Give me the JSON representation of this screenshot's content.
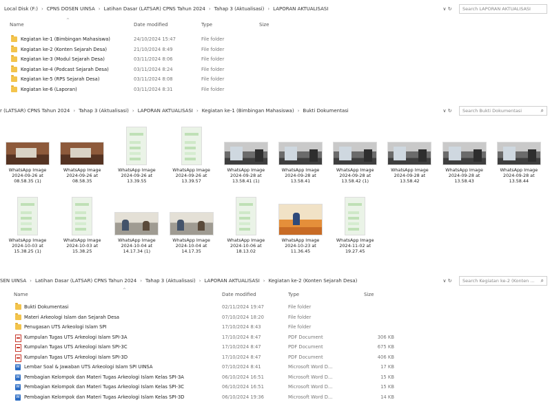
{
  "pane1": {
    "breadcrumb": [
      "Local Disk (F:)",
      "CPNS DOSEN UINSA",
      "Latihan Dasar (LATSAR) CPNS Tahun 2024",
      "Tahap 3 (Aktualisasi)",
      "LAPORAN AKTUALISASI"
    ],
    "search_placeholder": "Search LAPORAN AKTUALISASI",
    "columns": {
      "name": "Name",
      "date": "Date modified",
      "type": "Type",
      "size": "Size"
    },
    "rows": [
      {
        "name": "Kegiatan ke-1 (Bimbingan Mahasiswa)",
        "date": "24/10/2024 15:47",
        "type": "File folder",
        "size": ""
      },
      {
        "name": "Kegiatan ke-2 (Konten Sejarah Desa)",
        "date": "21/10/2024 8:49",
        "type": "File folder",
        "size": ""
      },
      {
        "name": "Kegiatan ke-3 (Modul Sejarah Desa)",
        "date": "03/11/2024 8:06",
        "type": "File folder",
        "size": ""
      },
      {
        "name": "Kegiatan ke-4 (Podcast Sejarah Desa)",
        "date": "03/11/2024 8:24",
        "type": "File folder",
        "size": ""
      },
      {
        "name": "Kegiatan ke-5 (RPS Sejarah Desa)",
        "date": "03/11/2024 8:08",
        "type": "File folder",
        "size": ""
      },
      {
        "name": "Kegiatan ke-6 (Laporan)",
        "date": "03/11/2024 8:31",
        "type": "File folder",
        "size": ""
      }
    ]
  },
  "pane2": {
    "breadcrumb": [
      "r (LATSAR) CPNS Tahun 2024",
      "Tahap 3 (Aktualisasi)",
      "LAPORAN AKTUALISASI",
      "Kegiatan ke-1 (Bimbingan Mahasiswa)",
      "Bukti Dokumentasi"
    ],
    "search_placeholder": "Search Bukti Dokumentasi",
    "tiles": [
      {
        "l1": "WhatsApp Image",
        "l2": "2024-09-26 at",
        "l3": "08.58.35 (1)",
        "kind": "desk"
      },
      {
        "l1": "WhatsApp Image",
        "l2": "2024-09-26 at",
        "l3": "08.58.35",
        "kind": "desk"
      },
      {
        "l1": "WhatsApp Image",
        "l2": "2024-09-26 at",
        "l3": "13.39.55",
        "kind": "chat"
      },
      {
        "l1": "WhatsApp Image",
        "l2": "2024-09-26 at",
        "l3": "13.39.57",
        "kind": "chat"
      },
      {
        "l1": "WhatsApp Image",
        "l2": "2024-09-28 at",
        "l3": "13.58.41 (1)",
        "kind": "room"
      },
      {
        "l1": "WhatsApp Image",
        "l2": "2024-09-28 at",
        "l3": "13.58.41",
        "kind": "room"
      },
      {
        "l1": "WhatsApp Image",
        "l2": "2024-09-28 at",
        "l3": "13.58.42 (1)",
        "kind": "room"
      },
      {
        "l1": "WhatsApp Image",
        "l2": "2024-09-28 at",
        "l3": "13.58.42",
        "kind": "room"
      },
      {
        "l1": "WhatsApp Image",
        "l2": "2024-09-28 at",
        "l3": "13.58.43",
        "kind": "room"
      },
      {
        "l1": "WhatsApp Image",
        "l2": "2024-09-28 at",
        "l3": "13.58.44",
        "kind": "room"
      },
      {
        "l1": "WhatsApp Image",
        "l2": "2024-10-03 at",
        "l3": "15.38.25 (1)",
        "kind": "chat"
      },
      {
        "l1": "WhatsApp Image",
        "l2": "2024-10-03 at",
        "l3": "15.38.25",
        "kind": "chat"
      },
      {
        "l1": "WhatsApp Image",
        "l2": "2024-10-04 at",
        "l3": "14.17.34 (1)",
        "kind": "meet"
      },
      {
        "l1": "WhatsApp Image",
        "l2": "2024-10-04 at",
        "l3": "14.17.35",
        "kind": "meet"
      },
      {
        "l1": "WhatsApp Image",
        "l2": "2024-10-06 at",
        "l3": "18.13.02",
        "kind": "chat"
      },
      {
        "l1": "WhatsApp Image",
        "l2": "2024-10-23 at",
        "l3": "11.36.45",
        "kind": "orange"
      },
      {
        "l1": "WhatsApp Image",
        "l2": "2024-11-02 at",
        "l3": "19.27.45",
        "kind": "chat"
      }
    ]
  },
  "pane3": {
    "breadcrumb": [
      "SEN UINSA",
      "Latihan Dasar (LATSAR) CPNS Tahun 2024",
      "Tahap 3 (Aktualisasi)",
      "LAPORAN AKTUALISASI",
      "Kegiatan ke-2 (Konten Sejarah Desa)"
    ],
    "search_placeholder": "Search Kegiatan ke-2 (Konten ...",
    "columns": {
      "name": "Name",
      "date": "Date modified",
      "type": "Type",
      "size": "Size"
    },
    "rows": [
      {
        "name": "Bukti Dokumentasi",
        "date": "02/11/2024 19:47",
        "type": "File folder",
        "size": "",
        "icon": "folder"
      },
      {
        "name": "Materi Arkeologi Islam dan Sejarah Desa",
        "date": "07/10/2024 18:20",
        "type": "File folder",
        "size": "",
        "icon": "folder"
      },
      {
        "name": "Penugasan UTS Arkeologi Islam SPI",
        "date": "17/10/2024 8:43",
        "type": "File folder",
        "size": "",
        "icon": "folder"
      },
      {
        "name": "Kumpulan Tugas UTS Arkeologi Islam SPI-3A",
        "date": "17/10/2024 8:47",
        "type": "PDF Document",
        "size": "306 KB",
        "icon": "pdf"
      },
      {
        "name": "Kumpulan Tugas UTS Arkeologi Islam SPI-3C",
        "date": "17/10/2024 8:47",
        "type": "PDF Document",
        "size": "675 KB",
        "icon": "pdf"
      },
      {
        "name": "Kumpulan Tugas UTS Arkeologi Islam SPI-3D",
        "date": "17/10/2024 8:47",
        "type": "PDF Document",
        "size": "406 KB",
        "icon": "pdf"
      },
      {
        "name": "Lembar Soal & Jawaban UTS Arkeologi Islam SPI UINSA",
        "date": "07/10/2024 8:41",
        "type": "Microsoft Word D...",
        "size": "17 KB",
        "icon": "docx"
      },
      {
        "name": "Pembagian Kelompok dan Materi Tugas Arkeologi Islam Kelas SPI-3A",
        "date": "06/10/2024 16:51",
        "type": "Microsoft Word D...",
        "size": "15 KB",
        "icon": "docx"
      },
      {
        "name": "Pembagian Kelompok dan Materi Tugas Arkeologi Islam Kelas SPI-3C",
        "date": "06/10/2024 16:51",
        "type": "Microsoft Word D...",
        "size": "15 KB",
        "icon": "docx"
      },
      {
        "name": "Pembagian Kelompok dan Materi Tugas Arkeologi Islam Kelas SPI-3D",
        "date": "06/10/2024 19:36",
        "type": "Microsoft Word D...",
        "size": "14 KB",
        "icon": "docx"
      }
    ]
  },
  "controls": {
    "dropdown": "∨",
    "refresh": "↻",
    "search_icon": "⌕",
    "sort_caret": "^"
  }
}
